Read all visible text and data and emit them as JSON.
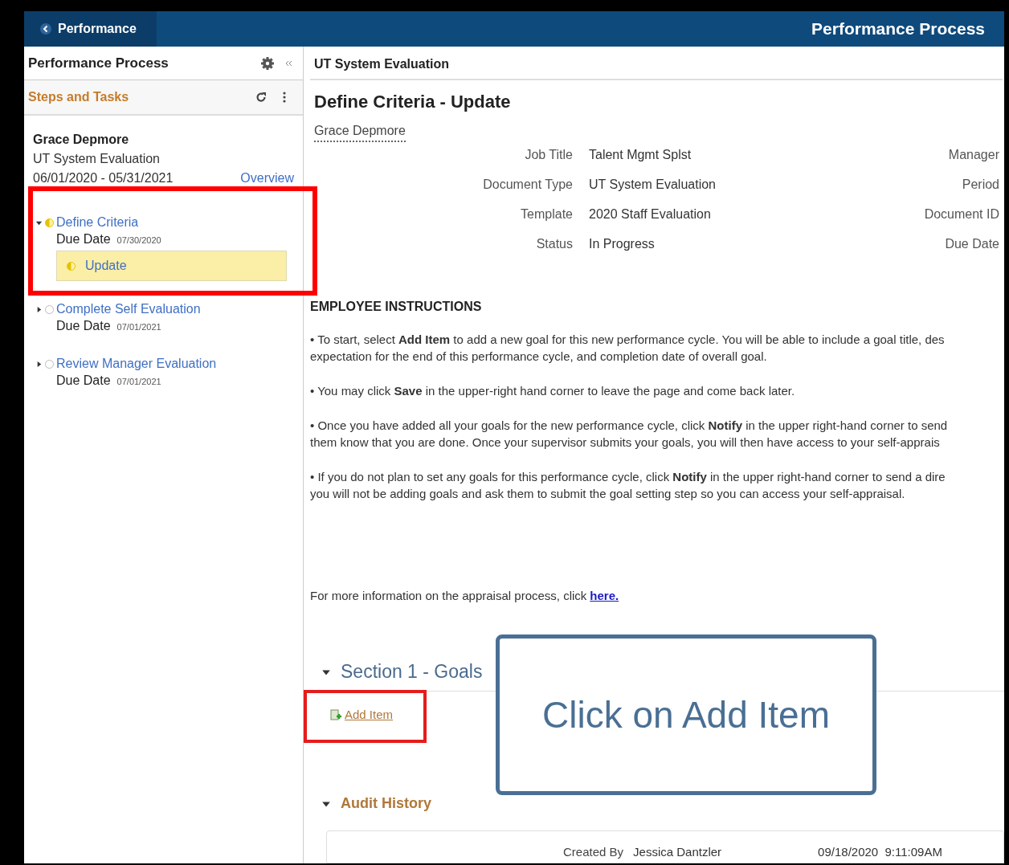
{
  "header": {
    "back_label": "Performance",
    "title": "Performance Process"
  },
  "sidebar": {
    "title": "Performance Process",
    "section_title": "Steps and Tasks",
    "employee": {
      "name": "Grace Depmore",
      "document": "UT System Evaluation",
      "start": "06/01/2020",
      "separator": "-",
      "end": "05/31/2021",
      "overview_link": "Overview"
    },
    "steps": [
      {
        "label": "Define Criteria",
        "in_progress": true,
        "expanded": true,
        "due_label": "Due Date",
        "due": "07/30/2020",
        "tasks": [
          {
            "label": "Update",
            "in_progress": true,
            "selected": true
          }
        ]
      },
      {
        "label": "Complete Self Evaluation",
        "in_progress": false,
        "expanded": false,
        "due_label": "Due Date",
        "due": "07/01/2021"
      },
      {
        "label": "Review Manager Evaluation",
        "in_progress": false,
        "expanded": false,
        "due_label": "Due Date",
        "due": "07/01/2021"
      }
    ]
  },
  "main": {
    "breadcrumb": "UT System Evaluation",
    "title": "Define Criteria - Update",
    "employee_link": "Grace Depmore",
    "fields": [
      {
        "label": "Job Title",
        "value": "Talent Mgmt Splst",
        "right_label": "Manager"
      },
      {
        "label": "Document Type",
        "value": "UT System Evaluation",
        "right_label": "Period"
      },
      {
        "label": "Template",
        "value": "2020 Staff Evaluation",
        "right_label": "Document ID"
      },
      {
        "label": "Status",
        "value": "In Progress",
        "right_label": "Due Date"
      }
    ],
    "instructions_title": "EMPLOYEE INSTRUCTIONS",
    "instructions": [
      [
        "• To start, select **Add Item** to add a new goal for this new performance cycle. You will be able to include a goal title, des",
        "expectation for the end of this performance cycle, and completion date of overall goal."
      ],
      [
        "• You may click **Save** in the upper-right hand corner to leave the page and come back later."
      ],
      [
        "• Once you have added all your goals for the new performance cycle, click **Notify** in the upper right-hand corner to send",
        "them know that you are done. Once your supervisor submits your goals, you will then have access to your self-apprais"
      ],
      [
        "• If you do not plan to set any goals for this performance cycle, click **Notify** in the upper right-hand corner to send a dire",
        "you will not be adding goals and ask them to submit the goal setting step so you can access your self-appraisal."
      ]
    ],
    "more_info": "For more information on the appraisal process, click",
    "more_info_link": "here.",
    "section": {
      "title": "Section 1 - Goals",
      "expanded": true,
      "add_item": "Add Item"
    },
    "audit": {
      "title": "Audit History",
      "expanded": true,
      "created_by_label": "Created By",
      "created_by": "Jessica Dantzler",
      "created_at": "09/18/2020  9:11:09AM"
    },
    "callout": "Click on Add Item"
  }
}
